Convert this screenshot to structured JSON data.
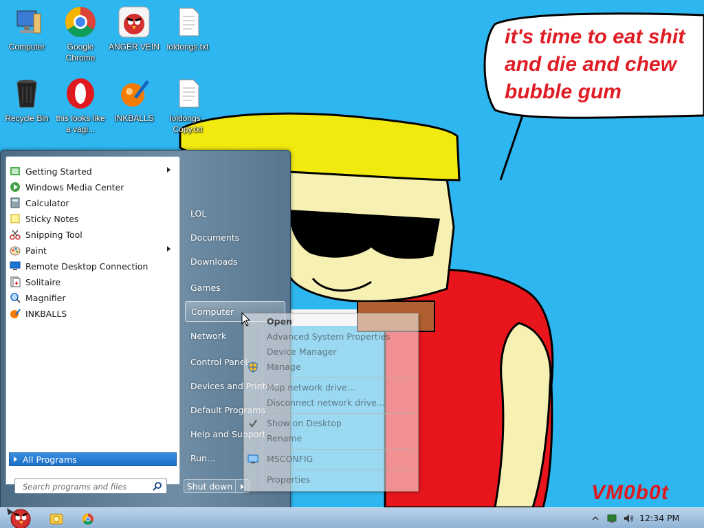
{
  "desktop": {
    "icons": [
      {
        "label": "Computer",
        "icon": "computer-icon"
      },
      {
        "label": "Google Chrome",
        "icon": "chrome-icon"
      },
      {
        "label": "ANGER VEIN",
        "icon": "angry-bird-icon"
      },
      {
        "label": "loldongs.txt",
        "icon": "text-file-icon"
      },
      {
        "label": "Recycle Bin",
        "icon": "recycle-bin-icon"
      },
      {
        "label": "this looks like a vagi...",
        "icon": "opera-icon"
      },
      {
        "label": "INKBALLS",
        "icon": "inkballs-icon"
      },
      {
        "label": "loldongs - Copy.txt",
        "icon": "text-file-icon"
      }
    ]
  },
  "wallpaper": {
    "speech_text": "it's time to eat shit\nand die and chew\nbubble gum",
    "signature": "VM0b0t",
    "colors": {
      "sky": "#2eb6f0",
      "hair": "#f2ea0e",
      "skin": "#f6f0b2",
      "shirt": "#e8161c",
      "text": "#e01c24"
    }
  },
  "start_menu": {
    "programs": [
      {
        "label": "Getting Started",
        "icon": "getting-started-icon",
        "submenu": true
      },
      {
        "label": "Windows Media Center",
        "icon": "media-center-icon",
        "submenu": false
      },
      {
        "label": "Calculator",
        "icon": "calculator-icon",
        "submenu": false
      },
      {
        "label": "Sticky Notes",
        "icon": "sticky-notes-icon",
        "submenu": false
      },
      {
        "label": "Snipping Tool",
        "icon": "scissors-icon",
        "submenu": false
      },
      {
        "label": "Paint",
        "icon": "paint-icon",
        "submenu": true
      },
      {
        "label": "Remote Desktop Connection",
        "icon": "remote-desktop-icon",
        "submenu": false
      },
      {
        "label": "Solitaire",
        "icon": "solitaire-icon",
        "submenu": false
      },
      {
        "label": "Magnifier",
        "icon": "magnifier-icon",
        "submenu": false
      },
      {
        "label": "INKBALLS",
        "icon": "inkballs-icon",
        "submenu": false
      }
    ],
    "all_programs": "All Programs",
    "search_placeholder": "Search programs and files",
    "right_items": [
      "LOL",
      "Documents",
      "Downloads",
      "Games",
      "Computer",
      "Network",
      "Control Panel",
      "Devices and Printers",
      "Default Programs",
      "Help and Support",
      "Run..."
    ],
    "hovered_item": "Computer",
    "shutdown": "Shut down"
  },
  "context_menu": {
    "open": "Open",
    "advanced": "Advanced System Properties",
    "device_manager": "Device Manager",
    "manage": "Manage",
    "map_drive": "Map network drive...",
    "disconnect_drive": "Disconnect network drive...",
    "show_on_desktop": "Show on Desktop",
    "rename": "Rename",
    "msconfig": "MSCONFIG",
    "properties": "Properties"
  },
  "taskbar": {
    "clock": "12:34 PM",
    "apps": [
      "explorer-icon",
      "chrome-icon"
    ]
  }
}
